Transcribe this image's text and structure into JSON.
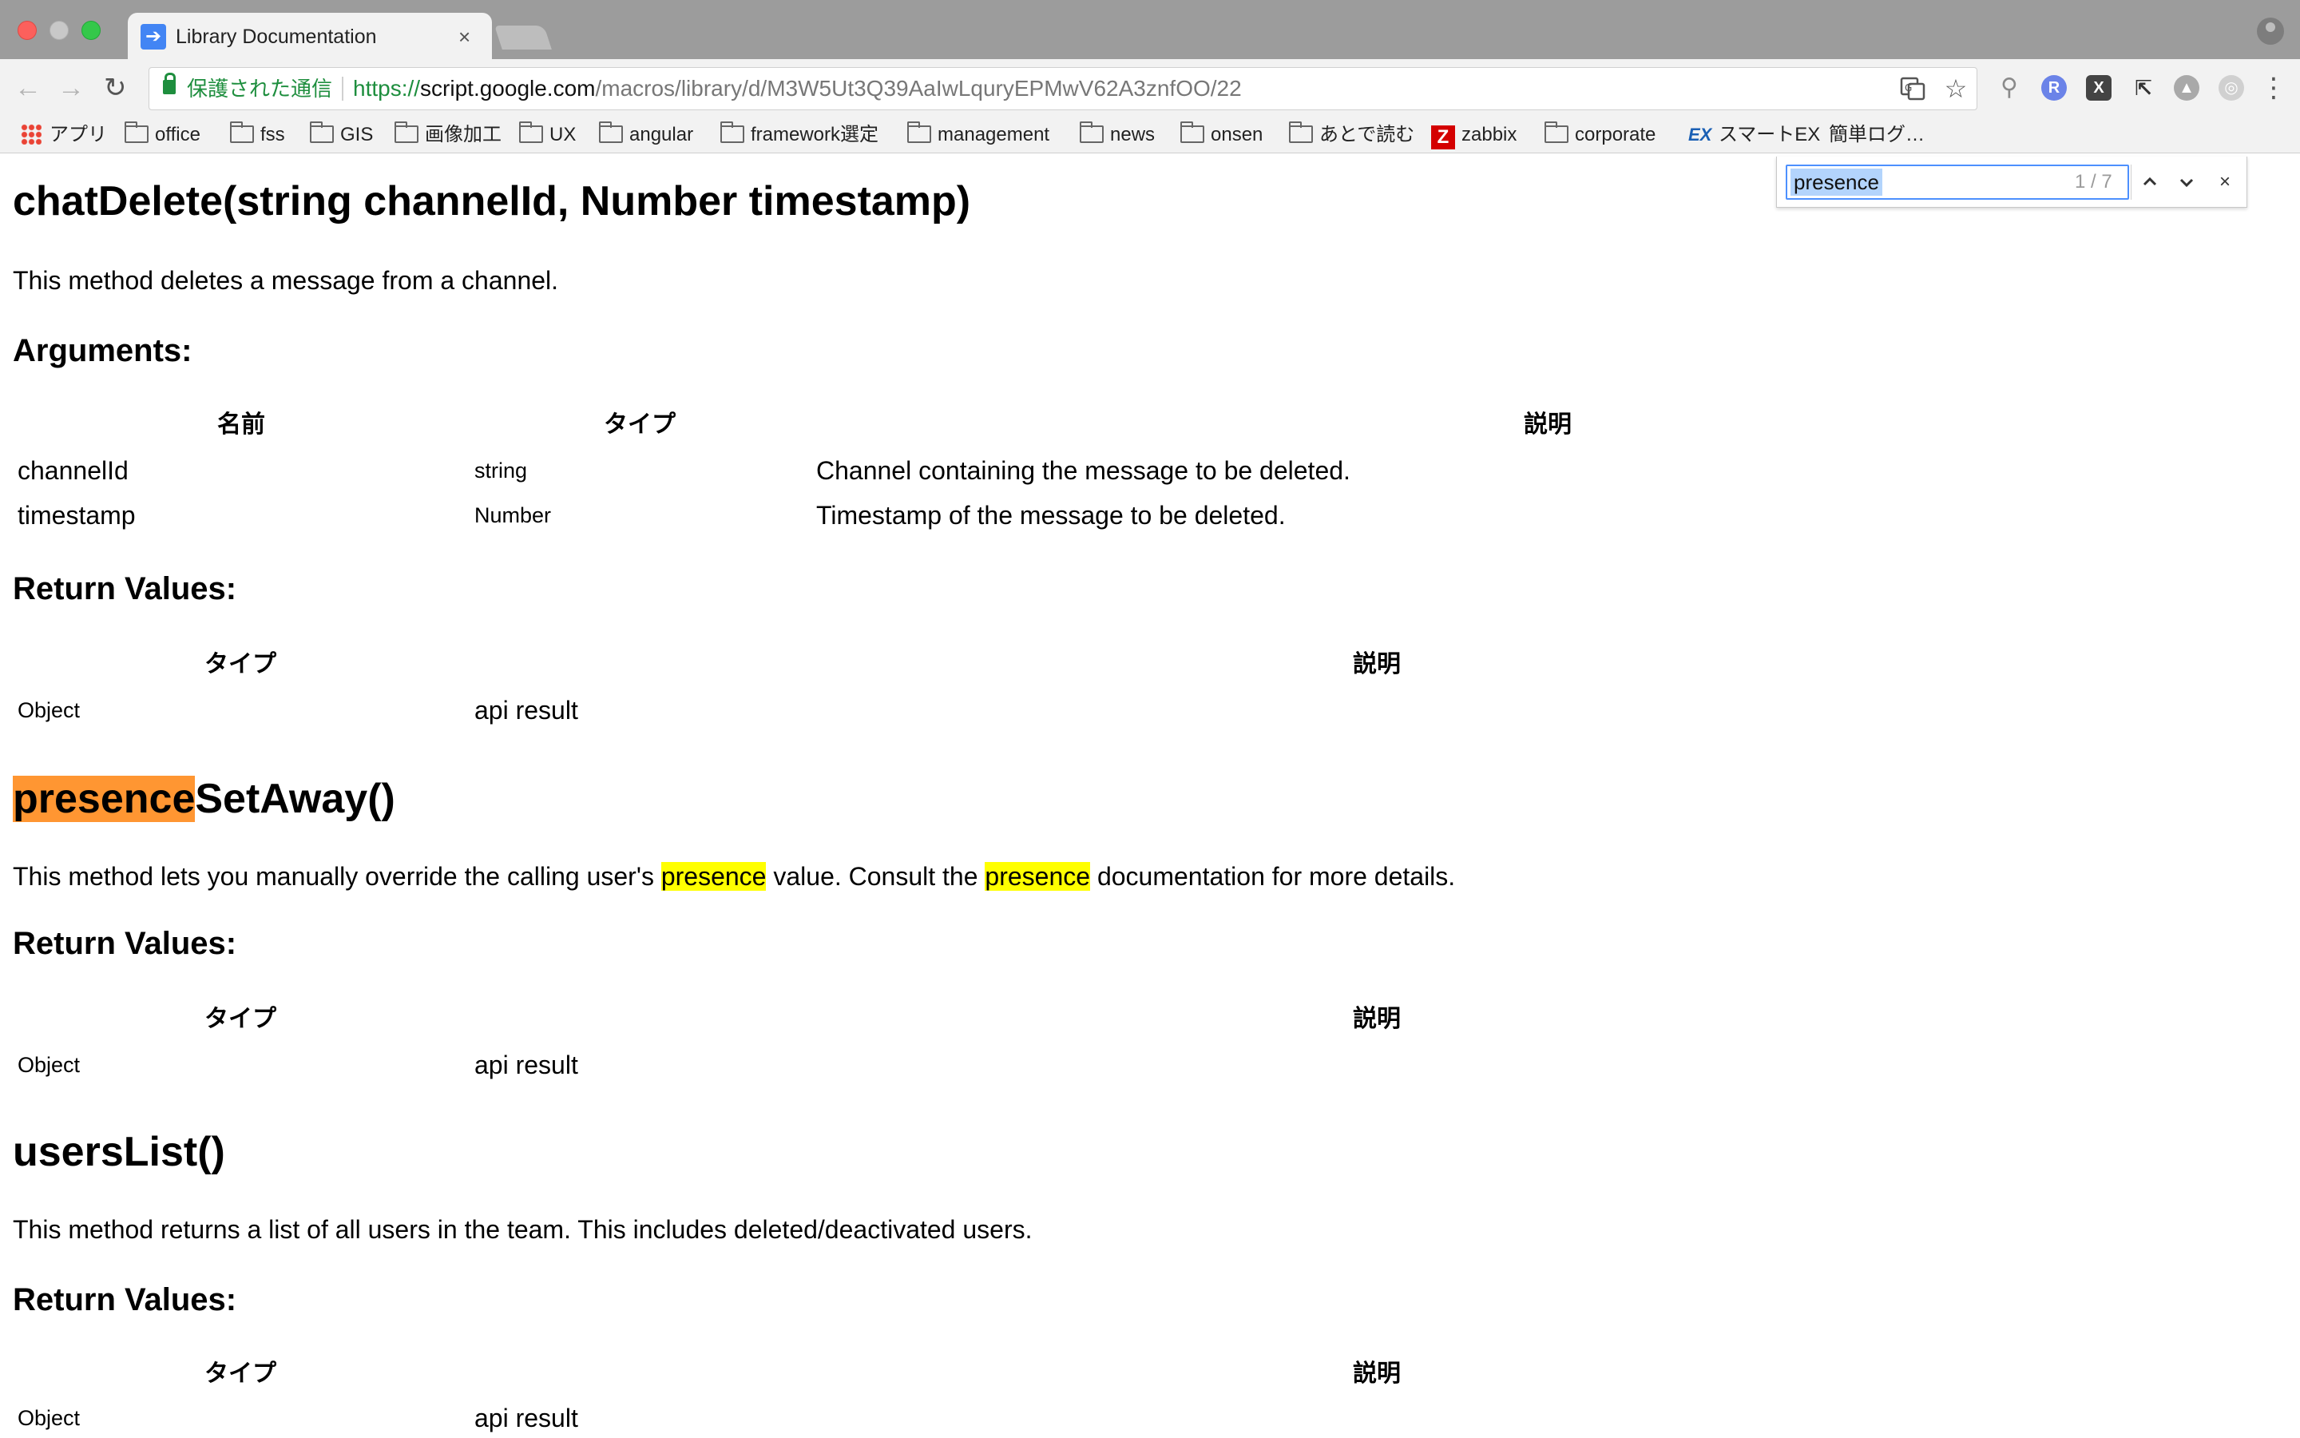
{
  "browser": {
    "tab_title": "Library Documentation",
    "tab_close": "×",
    "secure_label": "保護された通信",
    "url_scheme": "https://",
    "url_host": "script.google.com",
    "url_path": "/macros/library/d/M3W5Ut3Q39AaIwLquryEPMwV62A3znfOO/22",
    "nav_back": "←",
    "nav_forward": "→",
    "nav_reload": "↻",
    "menu": "⋮",
    "extension_labels": [
      "R",
      "X"
    ]
  },
  "bookmarks": [
    {
      "label": "アプリ",
      "icon": "apps-icon"
    },
    {
      "label": "office",
      "icon": "folder-icon"
    },
    {
      "label": "fss",
      "icon": "folder-icon"
    },
    {
      "label": "GIS",
      "icon": "folder-icon"
    },
    {
      "label": "画像加工",
      "icon": "folder-icon"
    },
    {
      "label": "UX",
      "icon": "folder-icon"
    },
    {
      "label": "angular",
      "icon": "folder-icon"
    },
    {
      "label": "framework選定",
      "icon": "folder-icon"
    },
    {
      "label": "management",
      "icon": "folder-icon"
    },
    {
      "label": "news",
      "icon": "folder-icon"
    },
    {
      "label": "onsen",
      "icon": "folder-icon"
    },
    {
      "label": "あとで読む",
      "icon": "folder-icon"
    },
    {
      "label": "zabbix",
      "icon": "zabbix-icon",
      "icon_text": "Z"
    },
    {
      "label": "corporate",
      "icon": "folder-icon"
    },
    {
      "label": "スマートEX",
      "icon": "ex-icon",
      "icon_text": "EX"
    },
    {
      "label": "簡単ログ…",
      "icon": "none"
    }
  ],
  "findbar": {
    "query": "presence",
    "count": "1 / 7",
    "prev": "⌃",
    "next": "⌄",
    "close": "×"
  },
  "doc": {
    "chat_delete": {
      "title": "chatDelete(string channelId, Number timestamp)",
      "description": "This method deletes a message from a channel.",
      "arguments_heading": "Arguments:",
      "arg_headers": [
        "名前",
        "タイプ",
        "説明"
      ],
      "args": [
        {
          "name": "channelId",
          "type": "string",
          "desc": "Channel containing the message to be deleted."
        },
        {
          "name": "timestamp",
          "type": "Number",
          "desc": "Timestamp of the message to be deleted."
        }
      ],
      "return_heading": "Return Values:",
      "return_headers": [
        "タイプ",
        "説明"
      ],
      "return_row": {
        "type": "Object",
        "desc": "api result"
      }
    },
    "presence_set_away": {
      "title_highlight": "presence",
      "title_rest": "SetAway()",
      "desc_part1": "This method lets you manually override the calling user's ",
      "desc_hl1": "presence",
      "desc_part2": " value. Consult the ",
      "desc_hl2": "presence",
      "desc_part3": " documentation for more details.",
      "return_heading": "Return Values:",
      "return_headers": [
        "タイプ",
        "説明"
      ],
      "return_row": {
        "type": "Object",
        "desc": "api result"
      }
    },
    "users_list": {
      "title": "usersList()",
      "description": "This method returns a list of all users in the team. This includes deleted/deactivated users.",
      "return_heading": "Return Values:",
      "return_headers": [
        "タイプ",
        "説明"
      ],
      "return_row": {
        "type": "Object",
        "desc": "api result"
      }
    }
  }
}
